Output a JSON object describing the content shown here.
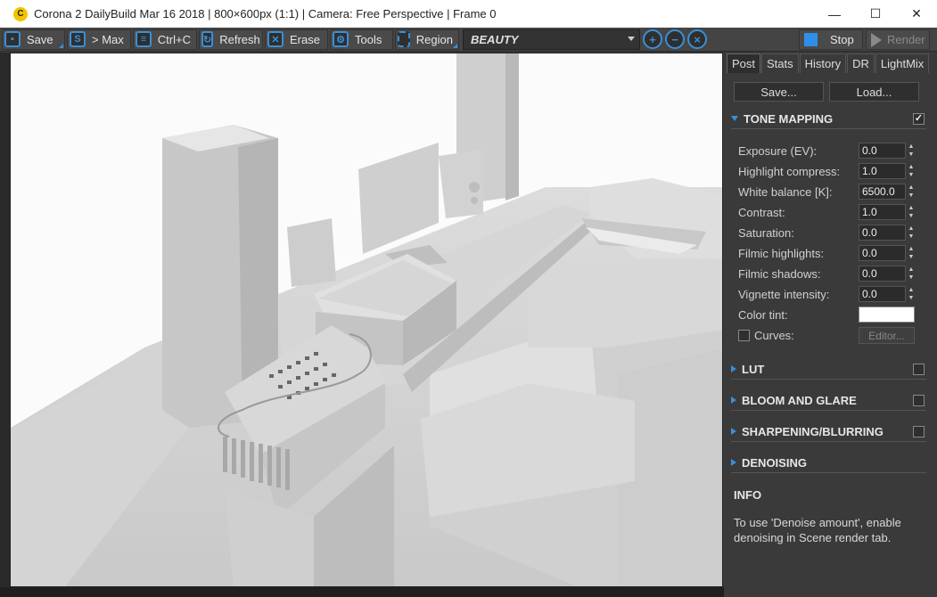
{
  "window": {
    "logo": "C",
    "title": "Corona 2 DailyBuild Mar 16 2018 | 800×600px (1:1) | Camera: Free Perspective | Frame 0",
    "minimize": "—",
    "maximize": "☐",
    "close": "✕"
  },
  "toolbar": {
    "save": "Save",
    "max": "> Max",
    "copy": "Ctrl+C",
    "refresh": "Refresh",
    "erase": "Erase",
    "tools": "Tools",
    "region": "Region",
    "pass": "BEAUTY",
    "stop": "Stop",
    "render": "Render"
  },
  "panel": {
    "tabs": [
      "Post",
      "Stats",
      "History",
      "DR",
      "LightMix"
    ],
    "save_btn": "Save...",
    "load_btn": "Load...",
    "tone_mapping": {
      "title": "TONE MAPPING",
      "check": "✓",
      "exposure_label": "Exposure (EV):",
      "exposure": "0.0",
      "highlight_label": "Highlight compress:",
      "highlight": "1.0",
      "wb_label": "White balance [K]:",
      "wb": "6500.0",
      "contrast_label": "Contrast:",
      "contrast": "1.0",
      "saturation_label": "Saturation:",
      "saturation": "0.0",
      "fh_label": "Filmic highlights:",
      "fh": "0.0",
      "fs_label": "Filmic shadows:",
      "fs": "0.0",
      "vignette_label": "Vignette intensity:",
      "vignette": "0.0",
      "tint_label": "Color tint:",
      "curves_label": "Curves:",
      "editor": "Editor..."
    },
    "lut": "LUT",
    "bloom": "BLOOM AND GLARE",
    "sharpen": "SHARPENING/BLURRING",
    "denoising": "DENOISING",
    "info_title": "INFO",
    "info_text": "To use 'Denoise amount', enable denoising in Scene render tab."
  },
  "colors": {
    "accent": "#3a8fd8",
    "stop": "#2f8fe8",
    "logo": "#f4c400"
  }
}
